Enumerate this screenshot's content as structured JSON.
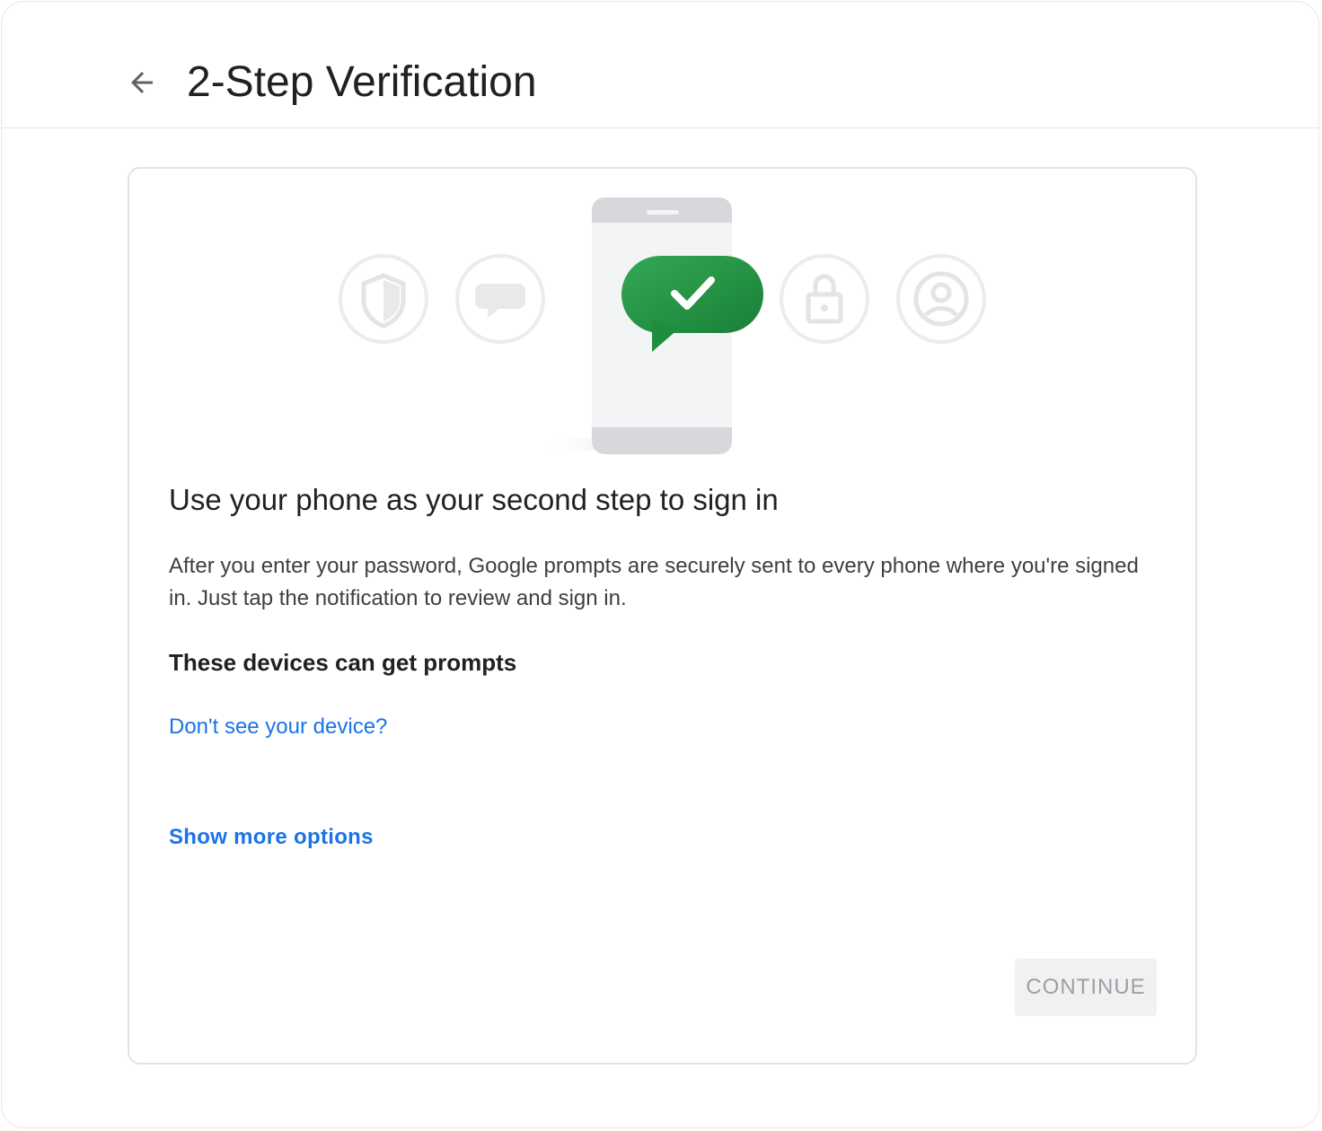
{
  "header": {
    "back_icon": "arrow-back-icon",
    "title": "2-Step Verification"
  },
  "hero": {
    "icons": [
      "shield-icon",
      "chat-bubble-icon",
      "phone-icon",
      "check-bubble-icon",
      "lock-icon",
      "account-icon"
    ],
    "accent_color": "#1e8e3e"
  },
  "content": {
    "heading": "Use your phone as your second step to sign in",
    "description": "After you enter your password, Google prompts are securely sent to every phone where you're signed in. Just tap the notification to review and sign in.",
    "devices_heading": "These devices can get prompts",
    "device_link": "Don't see your device?",
    "more_options_link": "Show more options"
  },
  "actions": {
    "continue_label": "CONTINUE",
    "continue_enabled": false
  },
  "colors": {
    "link": "#1a73e8",
    "text_primary": "#202124",
    "disabled_text": "#9aa0a6"
  }
}
